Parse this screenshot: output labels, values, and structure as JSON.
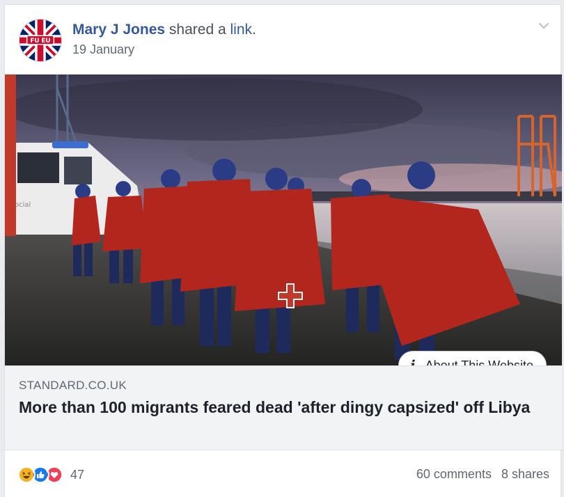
{
  "post": {
    "author_name": "Mary J Jones",
    "action_text": " shared a ",
    "link_word": "link",
    "period": ".",
    "date": "19 January",
    "avatar_badge_text": "FU EU"
  },
  "link_preview": {
    "about_label": "About This Website",
    "domain": "STANDARD.CO.UK",
    "headline": "More than 100 migrants feared dead 'after dingy capsized' off Libya",
    "image_van_text": "ocial"
  },
  "engagement": {
    "reaction_icons": [
      "haha-icon",
      "like-icon",
      "love-icon"
    ],
    "reaction_count": "47",
    "comments": "60 comments",
    "shares": "8 shares"
  },
  "colors": {
    "link_blue": "#365899",
    "like_blue": "#1877f2",
    "love_red": "#f33e58",
    "haha_yellow": "#f7b125",
    "muted_text": "#606770",
    "link_box_bg": "#f2f3f5"
  }
}
